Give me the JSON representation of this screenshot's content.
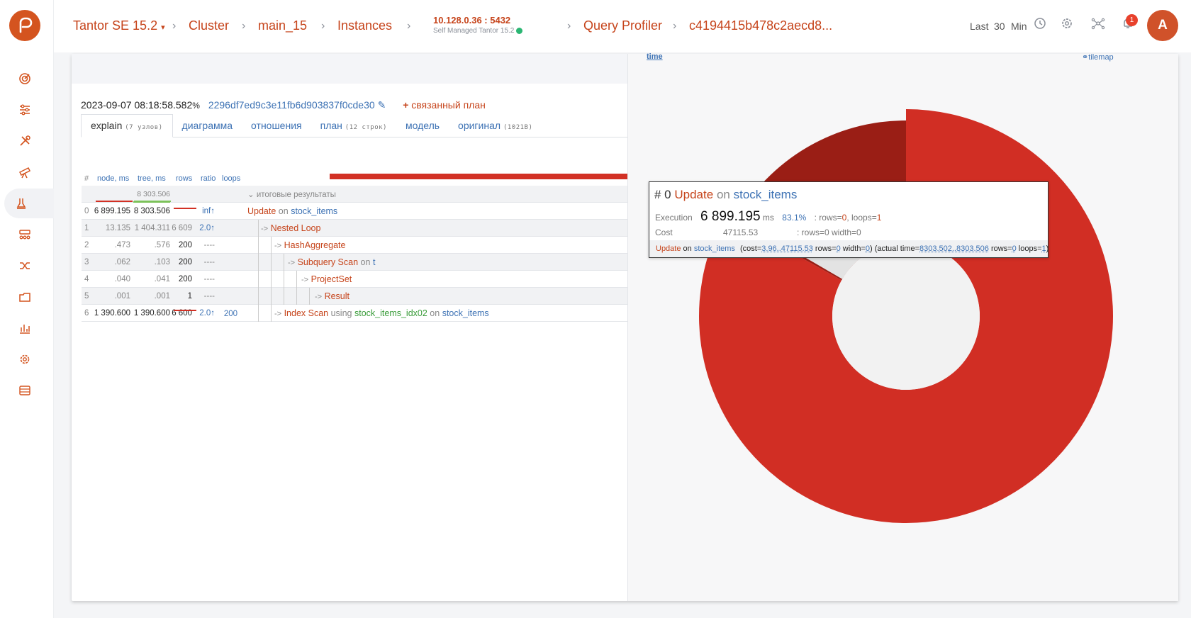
{
  "breadcrumb": {
    "product": "Tantor SE 15.2",
    "cluster": "Cluster",
    "db": "main_15",
    "instances": "Instances",
    "host": "10.128.0.36 : 5432",
    "host_sub": "Self Managed Tantor 15.2",
    "profiler": "Query Profiler",
    "query_id": "c4194415b478c2aecd8..."
  },
  "time_range": {
    "last": "Last",
    "value": "30",
    "unit": "Min"
  },
  "notifications": {
    "count": "1"
  },
  "user": {
    "initial": "A"
  },
  "plan": {
    "timestamp": "2023-09-07 08:18:58.582",
    "hash": "2296df7ed9c3e11fb6d903837f0cde30",
    "linked_plan": "связанный план"
  },
  "tabs": [
    {
      "label": "explain",
      "sub": "(7 узлов)"
    },
    {
      "label": "диаграмма",
      "sub": ""
    },
    {
      "label": "отношения",
      "sub": ""
    },
    {
      "label": "план",
      "sub": "(12 строк)"
    },
    {
      "label": "модель",
      "sub": ""
    },
    {
      "label": "оригинал",
      "sub": "(1021B)"
    }
  ],
  "table": {
    "headers": {
      "num": "#",
      "node": "node, ms",
      "tree": "tree, ms",
      "rows": "rows",
      "ratio": "ratio",
      "loops": "loops"
    },
    "summary": {
      "tree": "8 303.506",
      "label": "итоговые результаты"
    },
    "rows": [
      {
        "num": "0",
        "node_ms": "6 899.195",
        "tree_ms": "8 303.506",
        "rows": "",
        "ratio": "inf↑",
        "loops": "",
        "op": "Update",
        "on": "on",
        "rel": "stock_items",
        "depth": 0,
        "arrow": ""
      },
      {
        "num": "1",
        "node_ms": "13.135",
        "tree_ms": "1 404.311",
        "rows": "6 609",
        "ratio": "2.0↑",
        "loops": "",
        "op": "Nested Loop",
        "on": "",
        "rel": "",
        "depth": 1,
        "arrow": "->"
      },
      {
        "num": "2",
        "node_ms": ".473",
        "tree_ms": ".576",
        "rows": "200",
        "ratio": "----",
        "loops": "",
        "op": "HashAggregate",
        "on": "",
        "rel": "",
        "depth": 2,
        "arrow": "->"
      },
      {
        "num": "3",
        "node_ms": ".062",
        "tree_ms": ".103",
        "rows": "200",
        "ratio": "----",
        "loops": "",
        "op": "Subquery Scan",
        "on": "on",
        "rel": "t",
        "depth": 3,
        "arrow": "->"
      },
      {
        "num": "4",
        "node_ms": ".040",
        "tree_ms": ".041",
        "rows": "200",
        "ratio": "----",
        "loops": "",
        "op": "ProjectSet",
        "on": "",
        "rel": "",
        "depth": 4,
        "arrow": "->"
      },
      {
        "num": "5",
        "node_ms": ".001",
        "tree_ms": ".001",
        "rows": "1",
        "ratio": "----",
        "loops": "",
        "op": "Result",
        "on": "",
        "rel": "",
        "depth": 5,
        "arrow": "->"
      },
      {
        "num": "6",
        "node_ms": "1 390.600",
        "tree_ms": "1 390.600",
        "rows": "6 600",
        "ratio": "2.0↑",
        "loops": "200",
        "op": "Index Scan",
        "using": "using",
        "idx": "stock_items_idx02",
        "on": "on",
        "rel": "stock_items",
        "depth": 2,
        "arrow": "->"
      }
    ]
  },
  "chart_controls": {
    "time": "time",
    "tilemap": "tilemap"
  },
  "chart_data": {
    "type": "pie",
    "rings": [
      {
        "level": 0,
        "slices": [
          {
            "node": "Update",
            "share": 0.831
          },
          {
            "node": "Nested Loop",
            "share": 0.169
          }
        ]
      },
      {
        "level": 1,
        "slices": [
          {
            "node": "HashAggregate",
            "share": 0.0001
          },
          {
            "node": "Index Scan",
            "share": 0.1675
          }
        ]
      }
    ],
    "colors": {
      "update": "#d12e24",
      "nested_loop": "#9a1e15",
      "inner": "#e3e3e3",
      "hash": "#3a9c3a"
    }
  },
  "tooltip": {
    "num": "# 0",
    "op": "Update",
    "on": "on",
    "rel": "stock_items",
    "exec_label": "Execution",
    "exec_value": "6 899.195",
    "exec_unit": "ms",
    "exec_pct": "83.1%",
    "exec_rows_label": ": rows=",
    "exec_rows": "0",
    "exec_loops_label": ", loops=",
    "exec_loops": "1",
    "cost_label": "Cost",
    "cost_value": "47115.53",
    "cost_rows": ": rows=0 width=0",
    "line_op": "Update",
    "line_on": "on",
    "line_rel": "stock_items",
    "line_cost_pre": "(cost=",
    "line_cost": "3.96..47115.53",
    "line_rows_pre": "rows=",
    "line_rows": "0",
    "line_width_pre": "width=",
    "line_width": "0",
    "line_actual_pre": ") (actual time=",
    "line_actual": "8303.502..8303.506",
    "line_arows_pre": "rows=",
    "line_arows": "0",
    "line_loops_pre": "loops=",
    "line_loops": "1",
    "line_end": ")"
  }
}
